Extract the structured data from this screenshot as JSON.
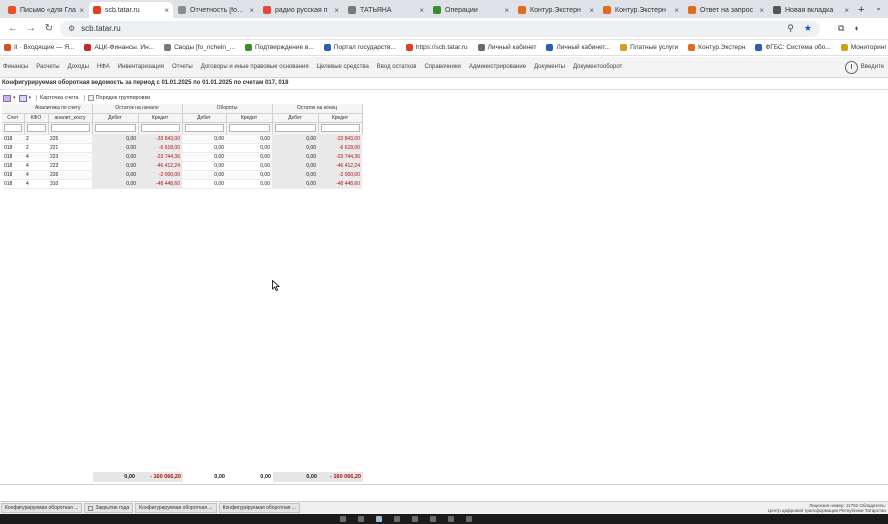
{
  "browser": {
    "tabs": [
      {
        "label": "Письмо «для Гла",
        "color": "#e8512a",
        "active": false
      },
      {
        "label": "scb.tatar.ru",
        "color": "#e2401e",
        "active": true
      },
      {
        "label": "Отчетность [fo_...",
        "color": "#8c8c8c",
        "active": false
      },
      {
        "label": "радио русская п",
        "color": "#e24a3a",
        "active": false
      },
      {
        "label": "ТАТЬЯНА",
        "color": "#7a7a7a",
        "active": false
      },
      {
        "label": "Операции",
        "color": "#3a8c2c",
        "active": false
      },
      {
        "label": "Контур.Экстерн",
        "color": "#e36b1e",
        "active": false
      },
      {
        "label": "Контур.Экстерн",
        "color": "#e36b1e",
        "active": false
      },
      {
        "label": "Ответ на запрос",
        "color": "#e36b1e",
        "active": false
      },
      {
        "label": "Новая вкладка",
        "color": "#555555",
        "active": false
      }
    ],
    "url": "scb.tatar.ru",
    "bookmarks": [
      {
        "label": "II · Входящие — Я...",
        "color": "#d6521e"
      },
      {
        "label": "АЦК-Финансы. Ин...",
        "color": "#c62a2a"
      },
      {
        "label": "Своды [fo_ncheln_...",
        "color": "#777777"
      },
      {
        "label": "Подтверждение в...",
        "color": "#3a8c2c"
      },
      {
        "label": "Портал государств...",
        "color": "#2a5fb5"
      },
      {
        "label": "https://scb.tatar.ru",
        "color": "#e2401e"
      },
      {
        "label": "Личный кабинет",
        "color": "#6a6a6a"
      },
      {
        "label": "Личный кабинет...",
        "color": "#2a5fb5"
      },
      {
        "label": "Платные услуги",
        "color": "#d1a017"
      },
      {
        "label": "Контур.Экстерн",
        "color": "#e36b1e"
      },
      {
        "label": "ФГБС: Система обо...",
        "color": "#2a5fb5"
      },
      {
        "label": "Мониторинг Дви...",
        "color": "#d1a017"
      }
    ]
  },
  "menu": {
    "items": [
      "Финансы",
      "Расчеты",
      "Доходы",
      "НФА",
      "Инвентаризация",
      "Отчеты",
      "Договоры и иные правовые основания",
      "Целевые средства",
      "Ввод остатков",
      "Справочники",
      "Администрирование",
      "Документы",
      "Документооборот"
    ],
    "enter": "Введите"
  },
  "report": {
    "title": "Конфигурируемая оборотная ведомость за период с 01.01.2025 по 01.01.2025 по счетам 017, 018"
  },
  "gridtools": {
    "card": "Карточка счета",
    "grouping": "Порядок группировки"
  },
  "grid": {
    "group_headers": {
      "analytics": "Аналитика по счету",
      "opening": "Остаток на начало",
      "turnover": "Обороты",
      "closing": "Остаток на конец"
    },
    "headers": [
      "Счет",
      "КФО",
      "аналит_косгу",
      "Дебет",
      "Кредит",
      "Дебет",
      "Кредит",
      "Дебет",
      "Кредит"
    ],
    "rows": [
      [
        "018",
        "2",
        "225",
        "0,00",
        "-33 843,00",
        "0,00",
        "0,00",
        "0,00",
        "-33 843,00"
      ],
      [
        "018",
        "2",
        "221",
        "0,00",
        "-6 618,00",
        "0,00",
        "0,00",
        "0,00",
        "-6 618,00"
      ],
      [
        "018",
        "4",
        "223",
        "0,00",
        "-23 744,36",
        "0,00",
        "0,00",
        "0,00",
        "-23 744,36"
      ],
      [
        "018",
        "4",
        "223",
        "0,00",
        "-46 412,24",
        "0,00",
        "0,00",
        "0,00",
        "-46 412,24"
      ],
      [
        "018",
        "4",
        "226",
        "0,00",
        "-2 000,00",
        "0,00",
        "0,00",
        "0,00",
        "-2 000,00"
      ],
      [
        "018",
        "4",
        "310",
        "0,00",
        "-48 448,60",
        "0,00",
        "0,00",
        "0,00",
        "-48 448,60"
      ]
    ],
    "totals": [
      "0,00",
      "- 160 066,20",
      "0,00",
      "0,00",
      "0,00",
      "- 160 066,20"
    ]
  },
  "apptabs": [
    "Конфигурируемая оборотная ...",
    "Закрытие года",
    "Конфигурируемая оборотная ...",
    "Конфигурируемая оборотная ..."
  ],
  "license": {
    "line1": "Лицензия номер: 11792 Обладатель:",
    "line2": "Центр цифровой трансформации Республики Татарстан"
  }
}
